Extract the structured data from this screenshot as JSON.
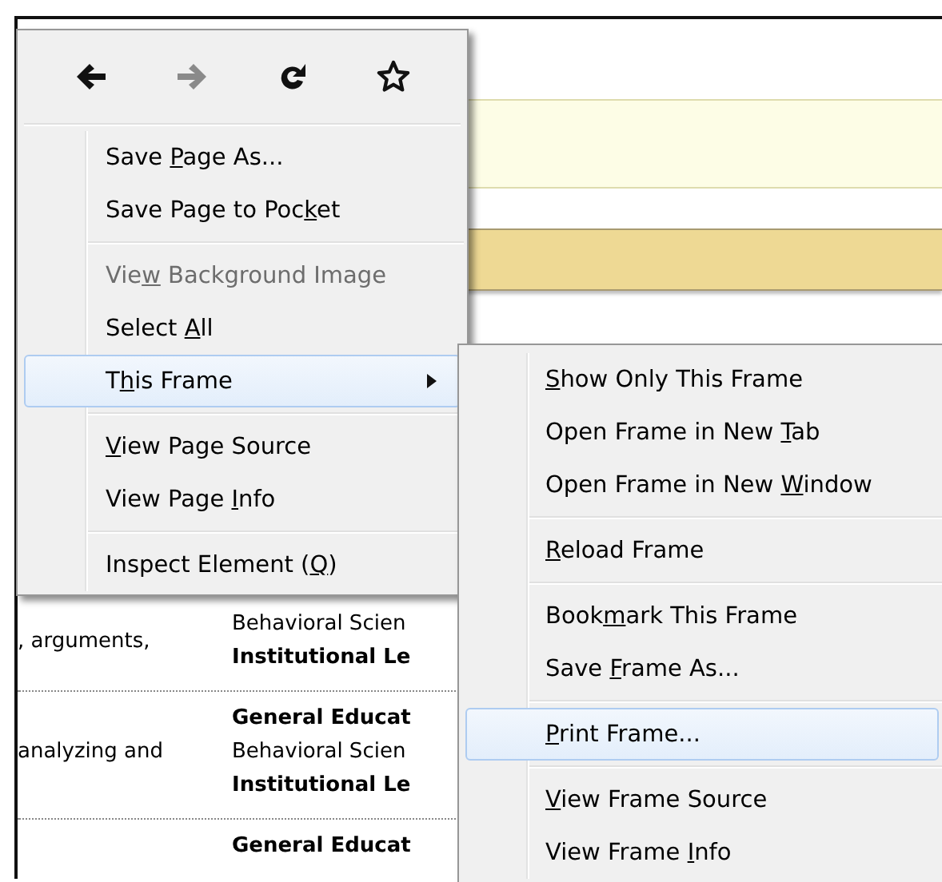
{
  "page": {
    "rows": [
      {
        "column_1": ", arguments,",
        "column_2": [
          {
            "text": "Behavioral Scien",
            "bold": false
          },
          {
            "text": "Institutional Le",
            "bold": true
          }
        ]
      },
      {
        "column_1": "analyzing and",
        "column_2": [
          {
            "text": "General Educat",
            "bold": true
          },
          {
            "text": "Behavioral Scien",
            "bold": false
          },
          {
            "text": "Institutional Le",
            "bold": true
          }
        ]
      },
      {
        "column_2": [
          {
            "text": "General Educat",
            "bold": true
          }
        ]
      }
    ]
  },
  "context_menu": {
    "nav_buttons": [
      {
        "kind": "back",
        "disabled": false
      },
      {
        "kind": "forward",
        "disabled": true
      },
      {
        "kind": "reload",
        "disabled": false
      },
      {
        "kind": "bookmark",
        "disabled": false
      }
    ],
    "items": [
      {
        "kind": "item",
        "pre": "Save ",
        "key": "P",
        "post": "age As...",
        "disabled": false,
        "selected": false,
        "has_submenu": false
      },
      {
        "kind": "item",
        "pre": "Save Page to Poc",
        "key": "k",
        "post": "et",
        "disabled": false,
        "selected": false,
        "has_submenu": false
      },
      {
        "kind": "separator"
      },
      {
        "kind": "item",
        "pre": "Vie",
        "key": "w",
        "post": " Background Image",
        "disabled": true,
        "selected": false,
        "has_submenu": false
      },
      {
        "kind": "item",
        "pre": "Select ",
        "key": "A",
        "post": "ll",
        "disabled": false,
        "selected": false,
        "has_submenu": false
      },
      {
        "kind": "item",
        "pre": "T",
        "key": "h",
        "post": "is Frame",
        "disabled": false,
        "selected": true,
        "has_submenu": true
      },
      {
        "kind": "separator"
      },
      {
        "kind": "item",
        "key": "V",
        "post": "iew Page Source",
        "disabled": false,
        "selected": false,
        "has_submenu": false
      },
      {
        "kind": "item",
        "pre": "View Page ",
        "key": "I",
        "post": "nfo",
        "disabled": false,
        "selected": false,
        "has_submenu": false
      },
      {
        "kind": "separator"
      },
      {
        "kind": "item",
        "pre": "Inspect Element (",
        "key": "Q",
        "post": ")",
        "disabled": false,
        "selected": false,
        "has_submenu": false
      }
    ]
  },
  "submenu": {
    "items": [
      {
        "kind": "item",
        "key": "S",
        "post": "how Only This Frame",
        "disabled": false,
        "selected": false
      },
      {
        "kind": "item",
        "pre": "Open Frame in New ",
        "key": "T",
        "post": "ab",
        "disabled": false,
        "selected": false
      },
      {
        "kind": "item",
        "pre": "Open Frame in New ",
        "key": "W",
        "post": "indow",
        "disabled": false,
        "selected": false
      },
      {
        "kind": "separator"
      },
      {
        "kind": "item",
        "key": "R",
        "post": "eload Frame",
        "disabled": false,
        "selected": false
      },
      {
        "kind": "separator"
      },
      {
        "kind": "item",
        "pre": "Book",
        "key": "m",
        "post": "ark This Frame",
        "disabled": false,
        "selected": false
      },
      {
        "kind": "item",
        "pre": "Save ",
        "key": "F",
        "post": "rame As...",
        "disabled": false,
        "selected": false
      },
      {
        "kind": "separator"
      },
      {
        "kind": "item",
        "key": "P",
        "post": "rint Frame...",
        "disabled": false,
        "selected": true
      },
      {
        "kind": "separator"
      },
      {
        "kind": "item",
        "key": "V",
        "post": "iew Frame Source",
        "disabled": false,
        "selected": false
      },
      {
        "kind": "item",
        "pre": "View Frame ",
        "key": "I",
        "post": "nfo",
        "disabled": false,
        "selected": false
      }
    ]
  }
}
